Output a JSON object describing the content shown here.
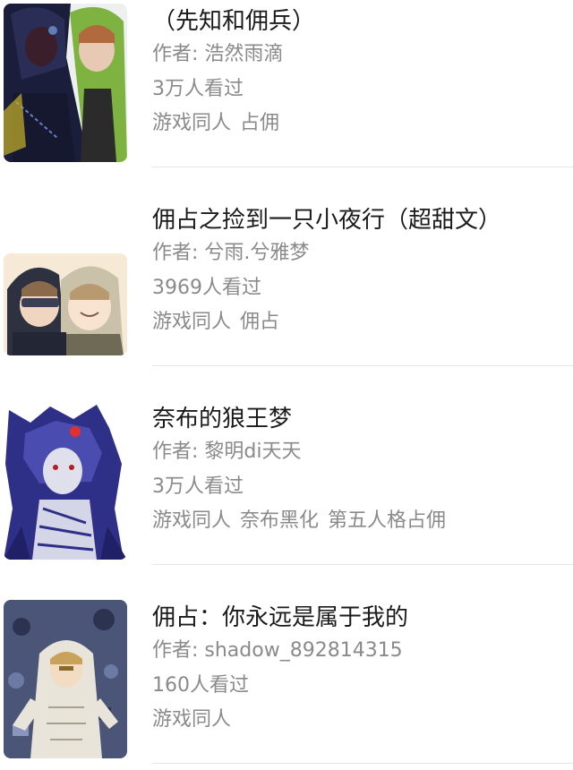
{
  "works": [
    {
      "title": "（先知和佣兵）",
      "author": "作者: 浩然雨滴",
      "views": "3万人看过",
      "tags": [
        "游戏同人",
        "占佣"
      ]
    },
    {
      "title": "佣占之捡到一只小夜行（超甜文）",
      "author": "作者: 兮雨.兮雅梦",
      "views": "3969人看过",
      "tags": [
        "游戏同人",
        "佣占"
      ]
    },
    {
      "title": "奈布的狼王梦",
      "author": "作者: 黎明di天天",
      "views": "3万人看过",
      "tags": [
        "游戏同人",
        "奈布黑化",
        "第五人格占佣"
      ]
    },
    {
      "title": "佣占：你永远是属于我的",
      "author": "作者: shadow_892814315",
      "views": "160人看过",
      "tags": [
        "游戏同人"
      ]
    }
  ]
}
